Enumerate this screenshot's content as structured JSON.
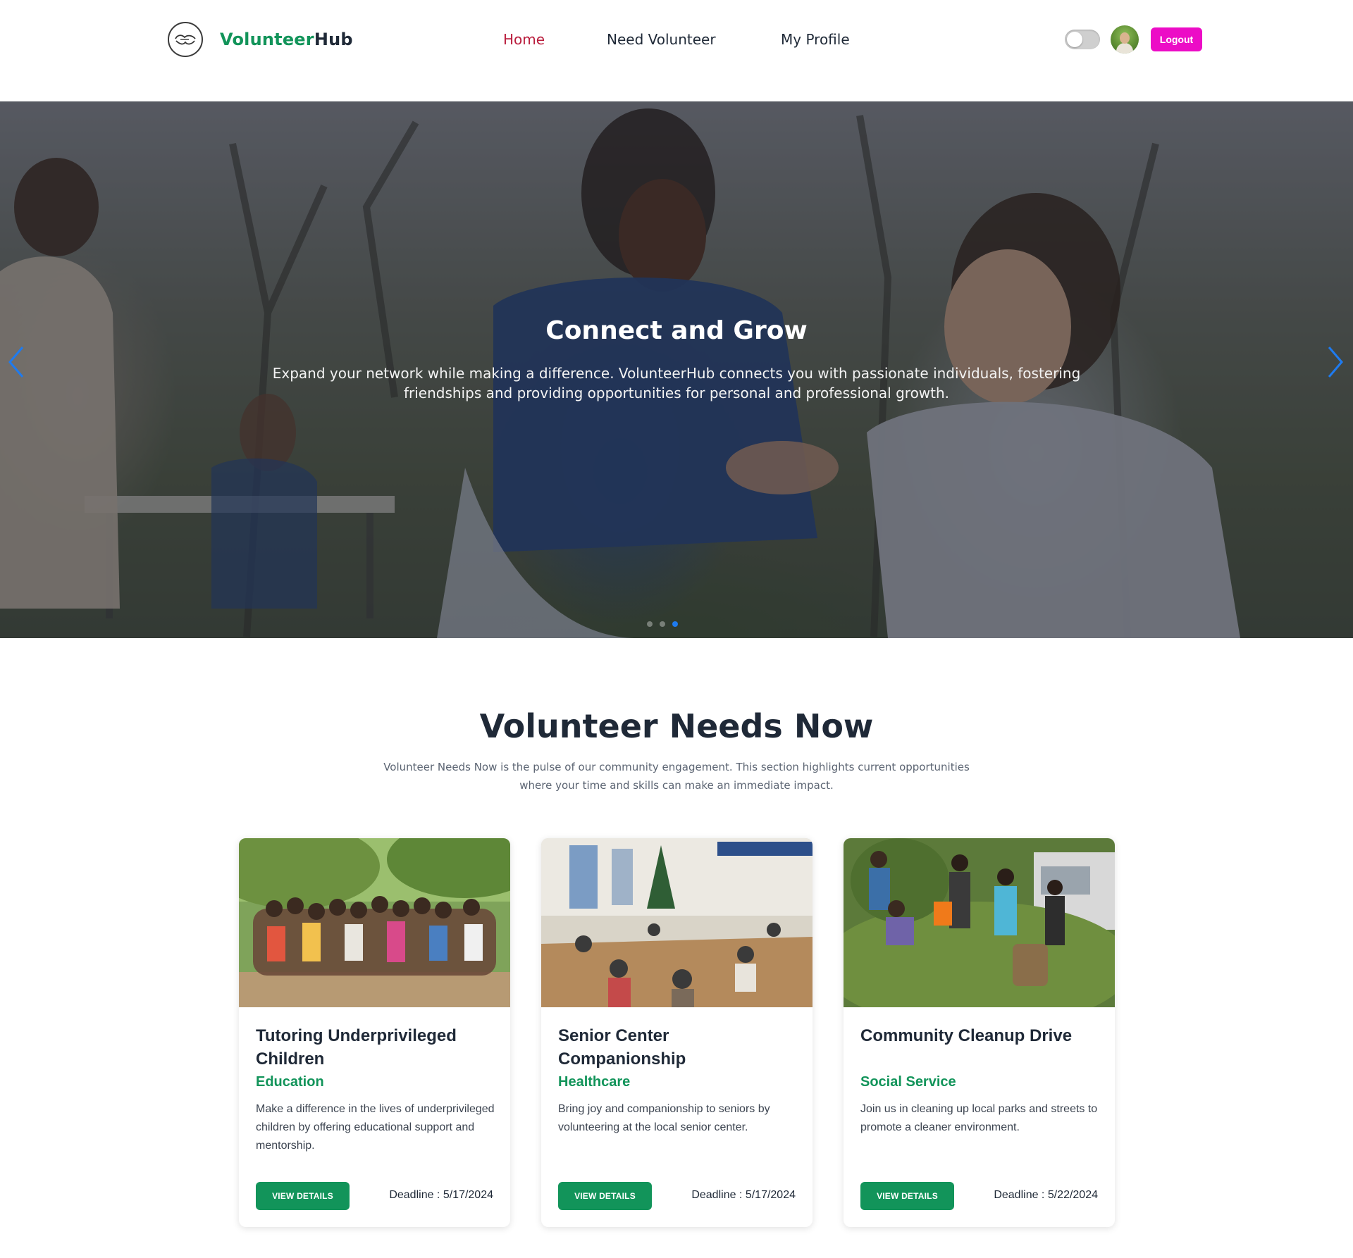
{
  "nav": {
    "brand_primary": "Volunteer",
    "brand_secondary": "Hub",
    "links": [
      {
        "label": "Home",
        "active": true
      },
      {
        "label": "Need Volunteer",
        "active": false
      },
      {
        "label": "My Profile",
        "active": false
      }
    ],
    "logout_label": "Logout",
    "theme_toggle_on": false
  },
  "hero": {
    "title": "Connect and Grow",
    "text": "Expand your network while making a difference. VolunteerHub connects you with passionate individuals, fostering friendships and providing opportunities for personal and professional growth.",
    "slide_count": 3,
    "active_slide": 3
  },
  "section": {
    "title": "Volunteer Needs Now",
    "subtitle": "Volunteer Needs Now is the pulse of our community engagement. This section highlights current opportunities where your time and skills can make an immediate impact."
  },
  "cards": [
    {
      "title": "Tutoring Underprivileged Children",
      "category": "Education",
      "description": "Make a difference in the lives of underprivileged children by offering educational support and mentorship.",
      "button_label": "VIEW DETAILS",
      "deadline": "Deadline : 5/17/2024"
    },
    {
      "title": "Senior Center Companionship",
      "category": "Healthcare",
      "description": "Bring joy and companionship to seniors by volunteering at the local senior center.",
      "button_label": "VIEW DETAILS",
      "deadline": "Deadline : 5/17/2024"
    },
    {
      "title": "Community Cleanup Drive",
      "category": "Social Service",
      "description": "Join us in cleaning up local parks and streets to promote a cleaner environment.",
      "button_label": "VIEW DETAILS",
      "deadline": "Deadline : 5/22/2024"
    }
  ],
  "colors": {
    "brand_green": "#12945a",
    "active_nav": "#b91c3c",
    "logout_magenta": "#ec0cc6",
    "carousel_dot_active": "#1e7bf0"
  },
  "icons": {
    "logo": "handshake-logo-icon",
    "prev": "chevron-left-icon",
    "next": "chevron-right-icon"
  }
}
